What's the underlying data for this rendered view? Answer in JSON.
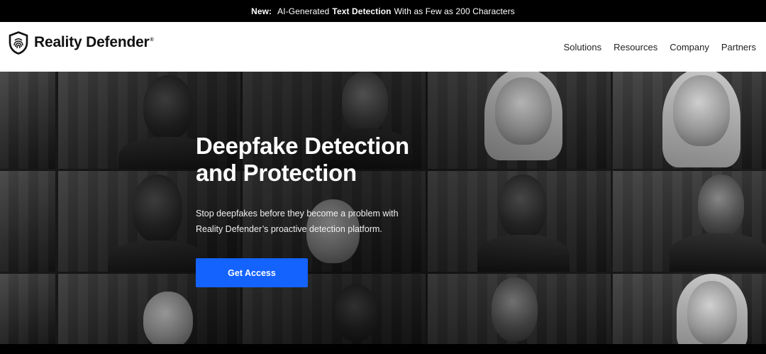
{
  "announcement": {
    "prefix": "New:",
    "text_before": "AI-Generated",
    "highlight": "Text Detection",
    "text_after": "With as Few as 200 Characters"
  },
  "brand": {
    "name": "Reality Defender",
    "reg": "®",
    "logo_icon": "shield-fingerprint-icon"
  },
  "nav": {
    "items": [
      "Solutions",
      "Resources",
      "Company",
      "Partners"
    ]
  },
  "hero": {
    "title_line1": "Deepfake Detection",
    "title_line2": "and Protection",
    "subtitle": "Stop deepfakes before they become a problem with Reality Defender’s proactive detection platform.",
    "cta_label": "Get Access"
  },
  "colors": {
    "accent": "#1463ff",
    "announcement_bg": "#000000",
    "nav_bg": "#ffffff"
  }
}
